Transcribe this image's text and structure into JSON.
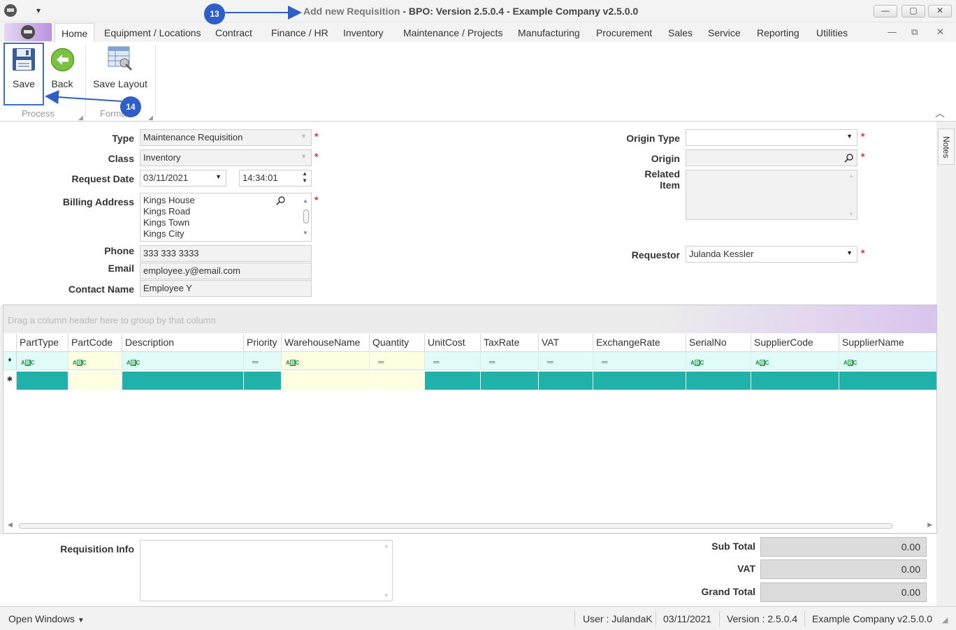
{
  "title": {
    "prefix": "Add new Requisition",
    "main": " - BPO: Version 2.5.0.4 - Example Company v2.5.0.0"
  },
  "window_controls": {
    "minimize": "—",
    "maximize": "▢",
    "close": "✕"
  },
  "tabs": [
    {
      "label": "Home",
      "active": true
    },
    {
      "label": "Equipment / Locations"
    },
    {
      "label": "Contract"
    },
    {
      "label": "Finance / HR"
    },
    {
      "label": "Inventory"
    },
    {
      "label": "Maintenance / Projects"
    },
    {
      "label": "Manufacturing"
    },
    {
      "label": "Procurement"
    },
    {
      "label": "Sales"
    },
    {
      "label": "Service"
    },
    {
      "label": "Reporting"
    },
    {
      "label": "Utilities"
    }
  ],
  "mdi_controls": {
    "minimize": "—",
    "restore": "⧉",
    "close": "✕"
  },
  "ribbon": {
    "buttons": {
      "save": "Save",
      "back": "Back",
      "save_layout": "Save Layout"
    },
    "groups": {
      "process": "Process",
      "format": "Format"
    }
  },
  "callouts": {
    "a": "13",
    "b": "14"
  },
  "form": {
    "type": {
      "label": "Type",
      "value": "Maintenance Requisition"
    },
    "class": {
      "label": "Class",
      "value": "Inventory"
    },
    "request_date": {
      "label": "Request Date",
      "date": "03/11/2021",
      "time": "14:34:01"
    },
    "billing_address": {
      "label": "Billing Address",
      "lines": [
        "Kings House",
        "Kings Road",
        "Kings Town",
        "Kings City"
      ]
    },
    "phone": {
      "label": "Phone",
      "value": "333 333 3333"
    },
    "email": {
      "label": "Email",
      "value": "employee.y@email.com"
    },
    "contact_name": {
      "label": "Contact Name",
      "value": "Employee Y"
    },
    "origin_type": {
      "label": "Origin Type",
      "value": ""
    },
    "origin": {
      "label": "Origin",
      "value": ""
    },
    "related_item": {
      "label_1": "Related",
      "label_2": "Item"
    },
    "requestor": {
      "label": "Requestor",
      "value": "Julanda Kessler"
    },
    "required_mark": "*"
  },
  "notes_tab": "Notes",
  "grid": {
    "group_panel_text": "Drag a column header here to group by that column",
    "columns": [
      "PartType",
      "PartCode",
      "Description",
      "Priority",
      "WarehouseName",
      "Quantity",
      "UnitCost",
      "TaxRate",
      "VAT",
      "ExchangeRate",
      "SerialNo",
      "SupplierCode",
      "SupplierName"
    ]
  },
  "totals": {
    "requisition_info_label": "Requisition Info",
    "sub_total": {
      "label": "Sub Total",
      "value": "0.00"
    },
    "vat": {
      "label": "VAT",
      "value": "0.00"
    },
    "grand_total": {
      "label": "Grand Total",
      "value": "0.00"
    }
  },
  "status_bar": {
    "open_windows": "Open Windows",
    "user": "User : JulandaK",
    "date": "03/11/2021",
    "version": "Version : 2.5.0.4",
    "company": "Example Company v2.5.0.0"
  },
  "colors": {
    "accent": "#2f5ec9",
    "new_row": "#20b2aa",
    "filter_row": "#dffcf9",
    "required": "#d33333"
  }
}
